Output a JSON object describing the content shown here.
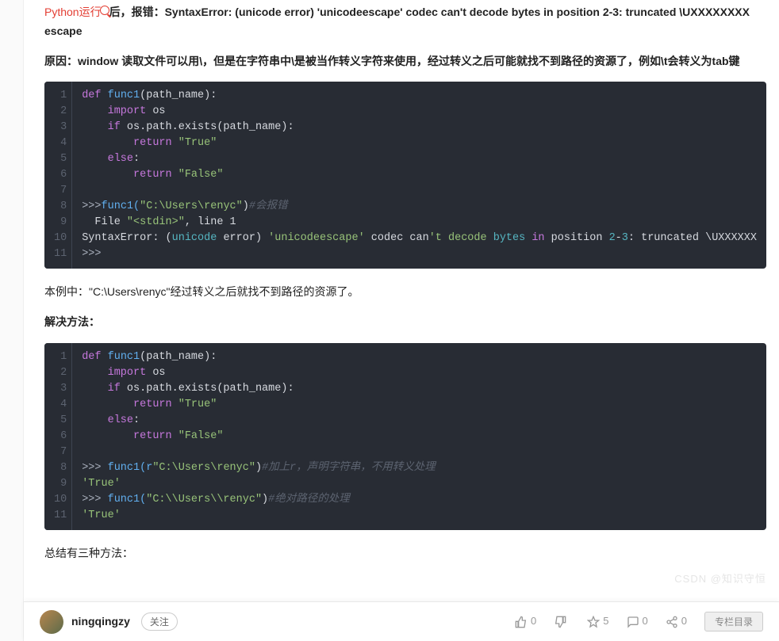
{
  "intro": {
    "python_link": "Python运行",
    "after_text": "后，报错：",
    "error_bold": "SyntaxError: (unicode error) 'unicodeescape' codec can't decode bytes in position 2-3: truncated \\UXXXXXXXX escape"
  },
  "reason": {
    "label": "原因：",
    "text": "window 读取文件可以用\\，但是在字符串中\\是被当作转义字符来使用，经过转义之后可能就找不到路径的资源了，例如\\t会转义为tab键"
  },
  "code1": {
    "lines": [
      "1",
      "2",
      "3",
      "4",
      "5",
      "6",
      "7",
      "8",
      "9",
      "10",
      "11"
    ],
    "l1_def": "def",
    "l1_name": " func1",
    "l1_rest": "(path_name):",
    "l2_kw": "    import",
    "l2_rest": " os",
    "l3_if": "    if",
    "l3_rest": " os.path.exists(path_name):",
    "l4_ret": "        return",
    "l4_str": " \"True\"",
    "l5_else": "    else",
    "l5_rest": ":",
    "l6_ret": "        return",
    "l6_str": " \"False\"",
    "l7": "",
    "l8_prompt": ">>>",
    "l8_call": "func1(",
    "l8_str": "\"C:\\Users\\renyc\"",
    "l8_close": ")",
    "l8_cmt": "#会报错",
    "l9": "  File ",
    "l9_str": "\"<stdin>\"",
    "l9_rest": ", line 1",
    "l10a": "SyntaxError: (",
    "l10b": "unicode",
    "l10c": " error) ",
    "l10d": "'unicodeescape'",
    "l10e": " codec can",
    "l10f": "'t decode ",
    "l10g": "bytes",
    "l10h": " in",
    "l10i": " position ",
    "l10j": "2",
    "l10k": "-",
    "l10l": "3",
    "l10m": ": truncated \\UXXXXXX",
    "l11": ">>>"
  },
  "mid": {
    "p1": "本例中：\"C:\\Users\\renyc\"经过转义之后就找不到路径的资源了。",
    "p2": "解决方法："
  },
  "code2": {
    "lines": [
      "1",
      "2",
      "3",
      "4",
      "5",
      "6",
      "7",
      "8",
      "9",
      "10",
      "11"
    ],
    "l1_def": "def",
    "l1_name": " func1",
    "l1_rest": "(path_name):",
    "l2_kw": "    import",
    "l2_rest": " os",
    "l3_if": "    if",
    "l3_rest": " os.path.exists(path_name):",
    "l4_ret": "        return",
    "l4_str": " \"True\"",
    "l5_else": "    else",
    "l5_rest": ":",
    "l6_ret": "        return",
    "l6_str": " \"False\"",
    "l7": "",
    "l8_prompt": ">>> ",
    "l8_call": "func1(r",
    "l8_str": "\"C:\\Users\\renyc\"",
    "l8_close": ")",
    "l8_cmt": "#加上r，声明字符串，不用转义处理",
    "l9_str": "'True'",
    "l10_prompt": ">>> ",
    "l10_call": "func1(",
    "l10_str": "\"C:\\\\Users\\\\renyc\"",
    "l10_close": ")",
    "l10_cmt": "#绝对路径的处理",
    "l11_str": "'True'"
  },
  "summary": "总结有三种方法：",
  "author": {
    "name": "ningqingzy",
    "follow": "关注"
  },
  "actions": {
    "like": "0",
    "dislike": "",
    "star": "5",
    "comment": "0",
    "share": "0",
    "collect": "专栏目录"
  },
  "watermark": "CSDN @知识守恒"
}
